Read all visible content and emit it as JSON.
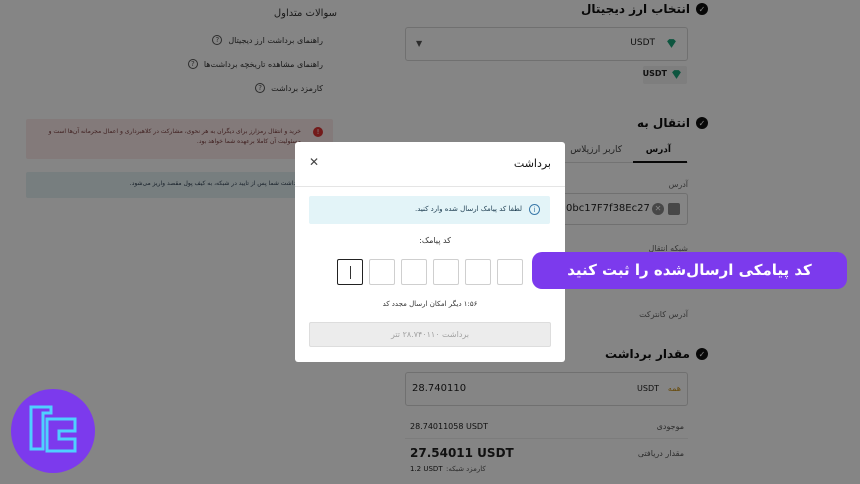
{
  "faq": {
    "title": "سوالات متداول",
    "items": [
      "راهنمای برداشت ارز دیجیتال",
      "راهنمای مشاهده تاریخچه برداشت‌ها",
      "کارمزد برداشت"
    ]
  },
  "warning": {
    "text": "خرید و انتقال رمزارز برای دیگران به هر نحوی، مشارکت در کلاهبرداری و اعمال مجرمانه آن‌ها است و مسئولیت آن کاملا برعهده شما خواهد بود."
  },
  "info_notice": {
    "text": "برداشت شما پس از تایید در شبکه، به کیف پول مقصد واریز می‌شود."
  },
  "steps": {
    "select_crypto": "انتخاب ارز دیجیتال",
    "transfer_to": "انتقال به",
    "withdraw_amount": "مقدار برداشت"
  },
  "crypto_select": {
    "value": "USDT",
    "chip": "USDT"
  },
  "transfer_tabs": [
    "آدرس",
    "کاربر ارزپلاس"
  ],
  "address": {
    "label": "آدرس",
    "value": "0bc17F7f38Ec27",
    "network_label": "شبکه انتقال",
    "contract_label": "آدرس کانترکت"
  },
  "amount": {
    "value": "28.740110",
    "currency": "USDT",
    "all_label": "همه",
    "balance_value": "28.74011058 USDT",
    "balance_label": "موجودی",
    "received_value": "27.54011 USDT",
    "received_label": "مقدار دریافتی",
    "fee_value": "1.2 USDT",
    "fee_label": "کارمزد شبکه:"
  },
  "modal": {
    "title": "برداشت",
    "close": "✕",
    "alert_text": "لطفا کد پیامک ارسال شده وارد کنید.",
    "code_label": "کد پیامک:",
    "code_digits": [
      "",
      "",
      "",
      "",
      "",
      ""
    ],
    "resend_text": "۱:۵۶ دیگر امکان ارسال مجدد کد",
    "submit_label": "برداشت ۲۸.۷۴۰۱۱۰ تتر"
  },
  "banner": {
    "text": "کد پیامکی ارسال‌شده را ثبت کنید"
  },
  "colors": {
    "accent": "#7c3aed",
    "logo_mark": "#4fd0ff",
    "gem": "#1aa37a"
  },
  "icons": {
    "check": "check-circle-icon",
    "question": "question-circle-icon",
    "close": "close-icon",
    "info": "info-icon",
    "gem": "tether-icon"
  }
}
